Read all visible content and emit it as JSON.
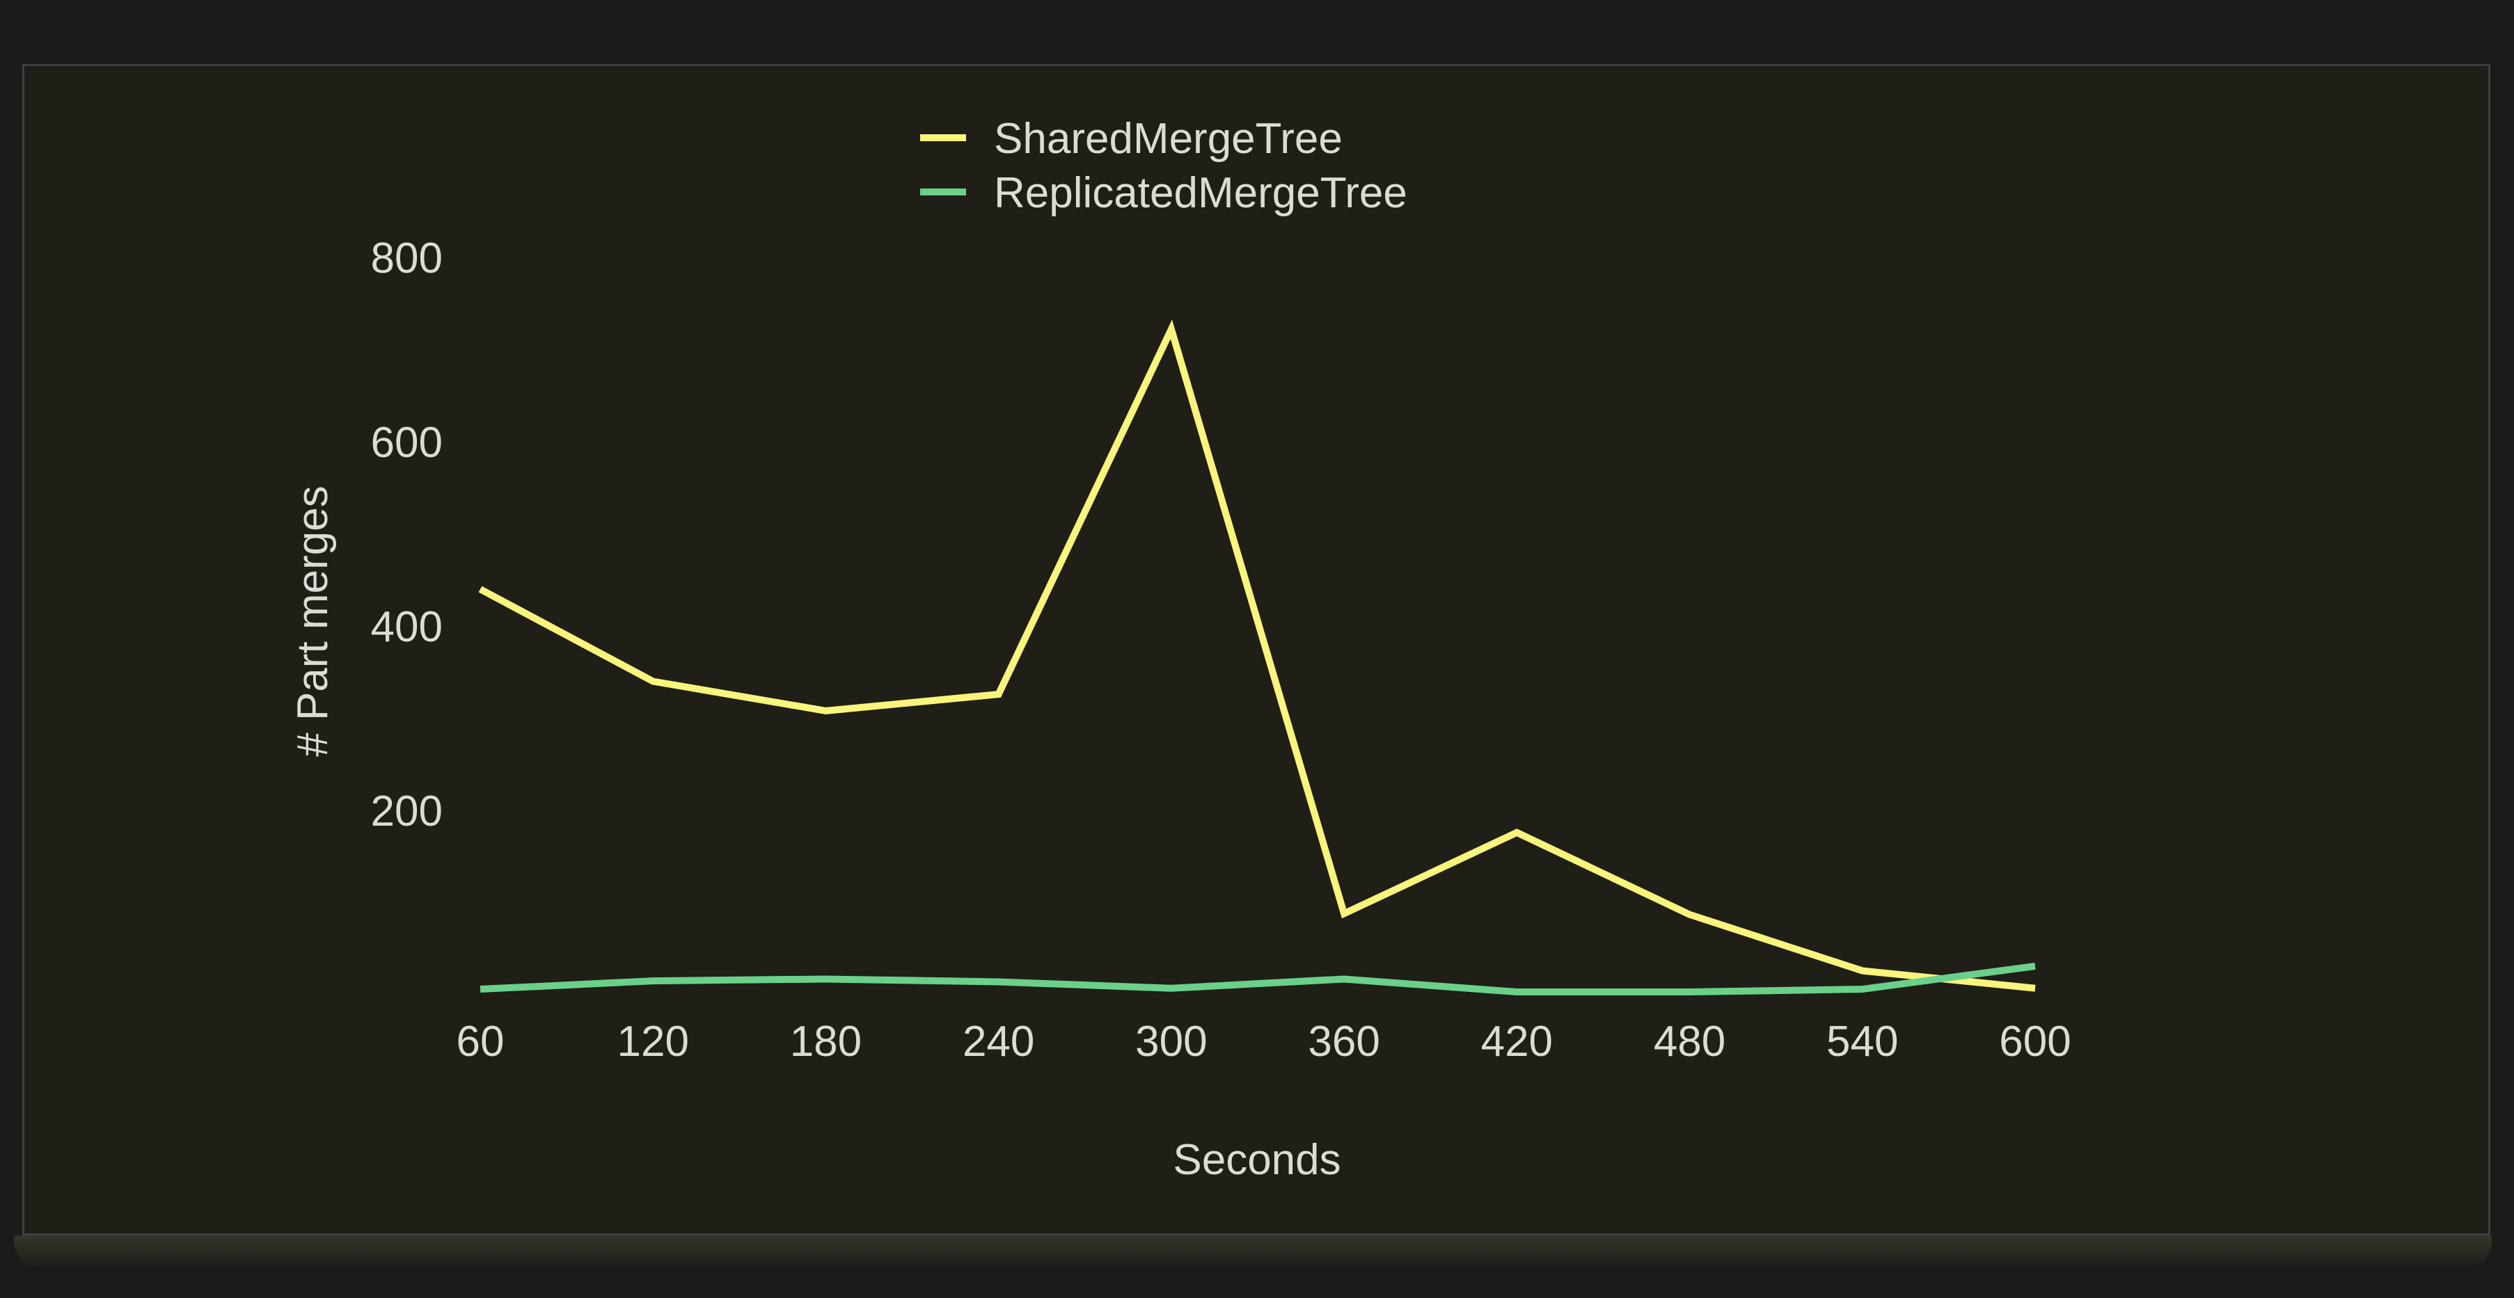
{
  "colors": {
    "background": "#1b1b1a",
    "panel": "#1f1f17",
    "text": "#dcdcd6",
    "shared": "#f8f47c",
    "replicated": "#6ad08a"
  },
  "chart_data": {
    "type": "line",
    "title": "",
    "xlabel": "Seconds",
    "ylabel": "# Part merges",
    "x": [
      60,
      120,
      180,
      240,
      300,
      360,
      420,
      480,
      540,
      600
    ],
    "x_ticks": [
      "60",
      "120",
      "180",
      "240",
      "300",
      "360",
      "420",
      "480",
      "540",
      "600"
    ],
    "y_ticks": [
      "200",
      "400",
      "600",
      "800"
    ],
    "xlim": [
      60,
      600
    ],
    "ylim": [
      0,
      800
    ],
    "grid": false,
    "legend_position": "top",
    "series": [
      {
        "name": "SharedMergeTree",
        "color": "#f8f47c",
        "values": [
          440,
          340,
          308,
          326,
          722,
          88,
          176,
          87,
          26,
          7
        ]
      },
      {
        "name": "ReplicatedMergeTree",
        "color": "#6ad08a",
        "values": [
          6,
          15,
          17,
          14,
          7,
          17,
          3,
          3,
          6,
          31
        ]
      }
    ]
  }
}
